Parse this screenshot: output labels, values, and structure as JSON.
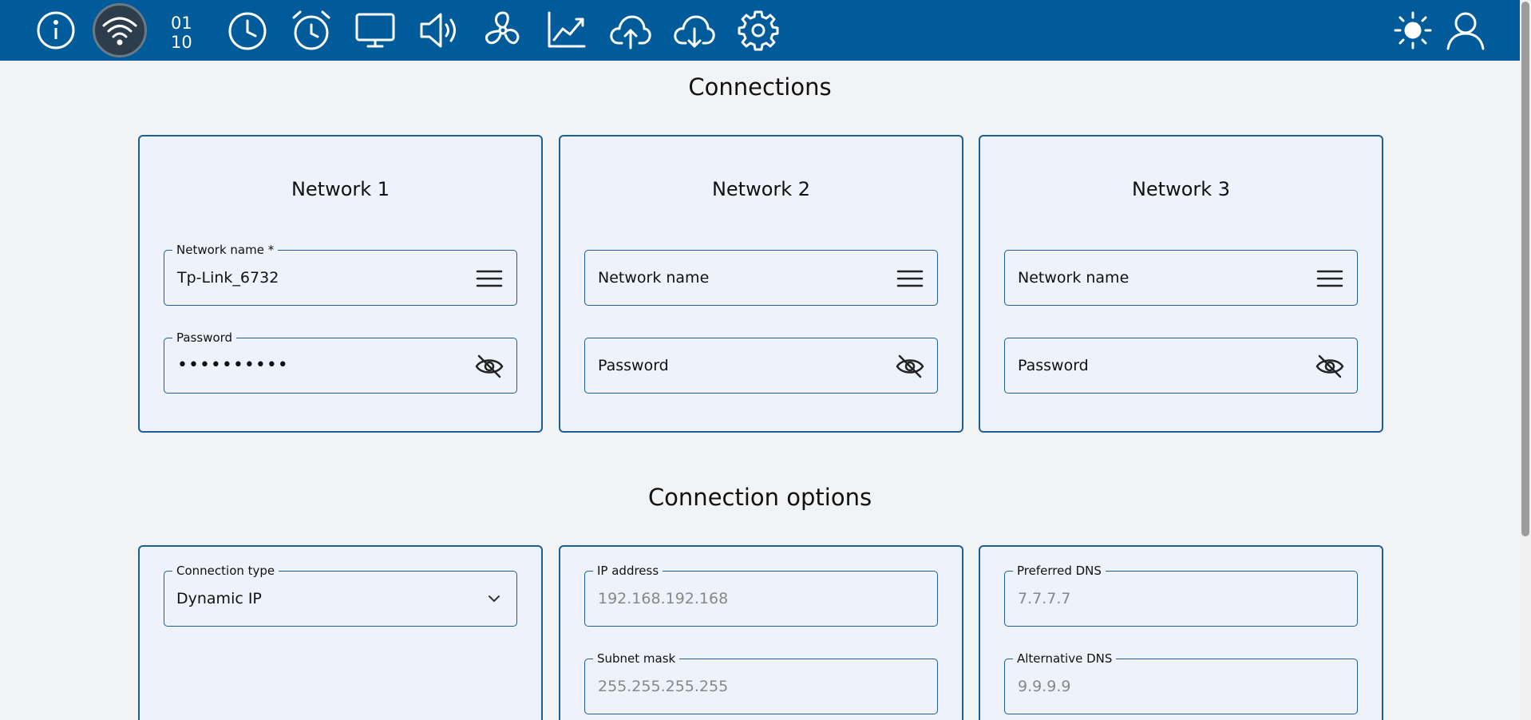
{
  "nav": {
    "items": [
      {
        "name": "info-icon"
      },
      {
        "name": "wifi-icon",
        "active": true
      },
      {
        "name": "binary-icon"
      },
      {
        "name": "clock-icon"
      },
      {
        "name": "alarm-icon"
      },
      {
        "name": "display-icon"
      },
      {
        "name": "speaker-icon"
      },
      {
        "name": "fan-icon"
      },
      {
        "name": "chart-icon"
      },
      {
        "name": "cloud-upload-icon"
      },
      {
        "name": "cloud-download-icon"
      },
      {
        "name": "gear-icon"
      }
    ],
    "right": [
      {
        "name": "brightness-icon"
      },
      {
        "name": "user-icon"
      }
    ],
    "binary_text": [
      "01",
      "10"
    ]
  },
  "colors": {
    "topbar": "#005b9a",
    "accent": "#1d5f93",
    "card_bg": "#eef2fa",
    "page_bg": "#f2f3f5"
  },
  "connections": {
    "title": "Connections",
    "networks": [
      {
        "title": "Network 1",
        "name_label": "Network name *",
        "name_value": "Tp-Link_6732",
        "password_label": "Password",
        "password_value": "••••••••••"
      },
      {
        "title": "Network 2",
        "name_placeholder": "Network name",
        "password_placeholder": "Password"
      },
      {
        "title": "Network 3",
        "name_placeholder": "Network name",
        "password_placeholder": "Password"
      }
    ]
  },
  "options": {
    "title": "Connection options",
    "connection_type": {
      "label": "Connection type",
      "value": "Dynamic IP"
    },
    "ip_address": {
      "label": "IP address",
      "placeholder": "192.168.192.168"
    },
    "subnet_mask": {
      "label": "Subnet mask",
      "placeholder": "255.255.255.255"
    },
    "preferred_dns": {
      "label": "Preferred DNS",
      "placeholder": "7.7.7.7"
    },
    "alternative_dns": {
      "label": "Alternative DNS",
      "placeholder": "9.9.9.9"
    }
  }
}
